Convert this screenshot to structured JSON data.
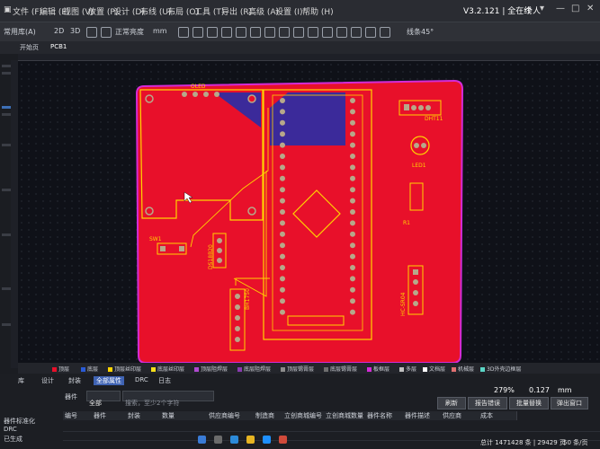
{
  "menu": {
    "items": [
      "文件 (F)",
      "编辑 (E)",
      "视图 (V)",
      "放置 (P)",
      "设计 (D)",
      "布线 (U)",
      "布局 (O)",
      "工具 (T)",
      "导出 (R)",
      "高级 (A)",
      "设置 (I)",
      "帮助 (H)"
    ],
    "version": "V3.2.121 | 全在线",
    "user": "个人"
  },
  "toolbar": {
    "left": "常用库(A)",
    "zoom_mode": "正常亮度",
    "unit": "mm",
    "route_angle": "线条45°",
    "mode_3d": "3D"
  },
  "doc_tabs": [
    "开始页",
    "PCB1"
  ],
  "board": {
    "silk_oled": "OLED",
    "silk_dht11": "DHT11",
    "silk_led1": "LED1",
    "silk_r1": "R1",
    "silk_sw1": "SW1",
    "silk_jp": "DS18B20",
    "silk_bh": "BH1750",
    "silk_hc": "HC-SR04"
  },
  "colors": {
    "board": "#e8102a",
    "outline": "#d42bd6",
    "silk": "#ffd400",
    "copper_pad": "#b7a88a",
    "blue_area": "#3b2a9a",
    "canvas": "#0f1118"
  },
  "layers": [
    {
      "name": "顶层",
      "color": "#e8102a"
    },
    {
      "name": "底层",
      "color": "#2a5bd6"
    },
    {
      "name": "顶层丝印层",
      "color": "#ffd400"
    },
    {
      "name": "底层丝印层",
      "color": "#f7e01a"
    },
    {
      "name": "顶层阻焊层",
      "color": "#b04ad0"
    },
    {
      "name": "底层阻焊层",
      "color": "#8a3bb0"
    },
    {
      "name": "顶层锡膏层",
      "color": "#8c8c8c"
    },
    {
      "name": "底层锡膏层",
      "color": "#6e6e6e"
    },
    {
      "name": "板框层",
      "color": "#d42bd6"
    },
    {
      "name": "多层",
      "color": "#c0c0c0"
    },
    {
      "name": "文档层",
      "color": "#ffffff"
    },
    {
      "name": "机械层",
      "color": "#e07070"
    },
    {
      "name": "3D外壳边框层",
      "color": "#5bd6c6"
    }
  ],
  "view": {
    "zoom": "279%",
    "grid": "0.127",
    "grid_unit": "mm"
  },
  "bottom_panel": {
    "tabs": [
      "库",
      "设计",
      "封装",
      "属性",
      "DRC",
      "日志"
    ],
    "active_tab": "全部属性",
    "filter_label": "器件",
    "filter_value": "全部",
    "search_placeholder": "搜索，至少2个字符",
    "buttons": [
      "刷新",
      "报告错误",
      "批量替换",
      "弹出窗口"
    ],
    "columns": [
      "编号",
      "器件",
      "封装",
      "数量",
      "供应商编号",
      "制造商",
      "立创商城编号",
      "立创商城数量",
      "器件名称",
      "器件描述",
      "供应商",
      "成本"
    ],
    "side_labels": [
      "器件标准化",
      "DRC",
      "已生成"
    ],
    "status": "总计 1471428 条 | 29429 页",
    "page_size": "50 条/页"
  }
}
